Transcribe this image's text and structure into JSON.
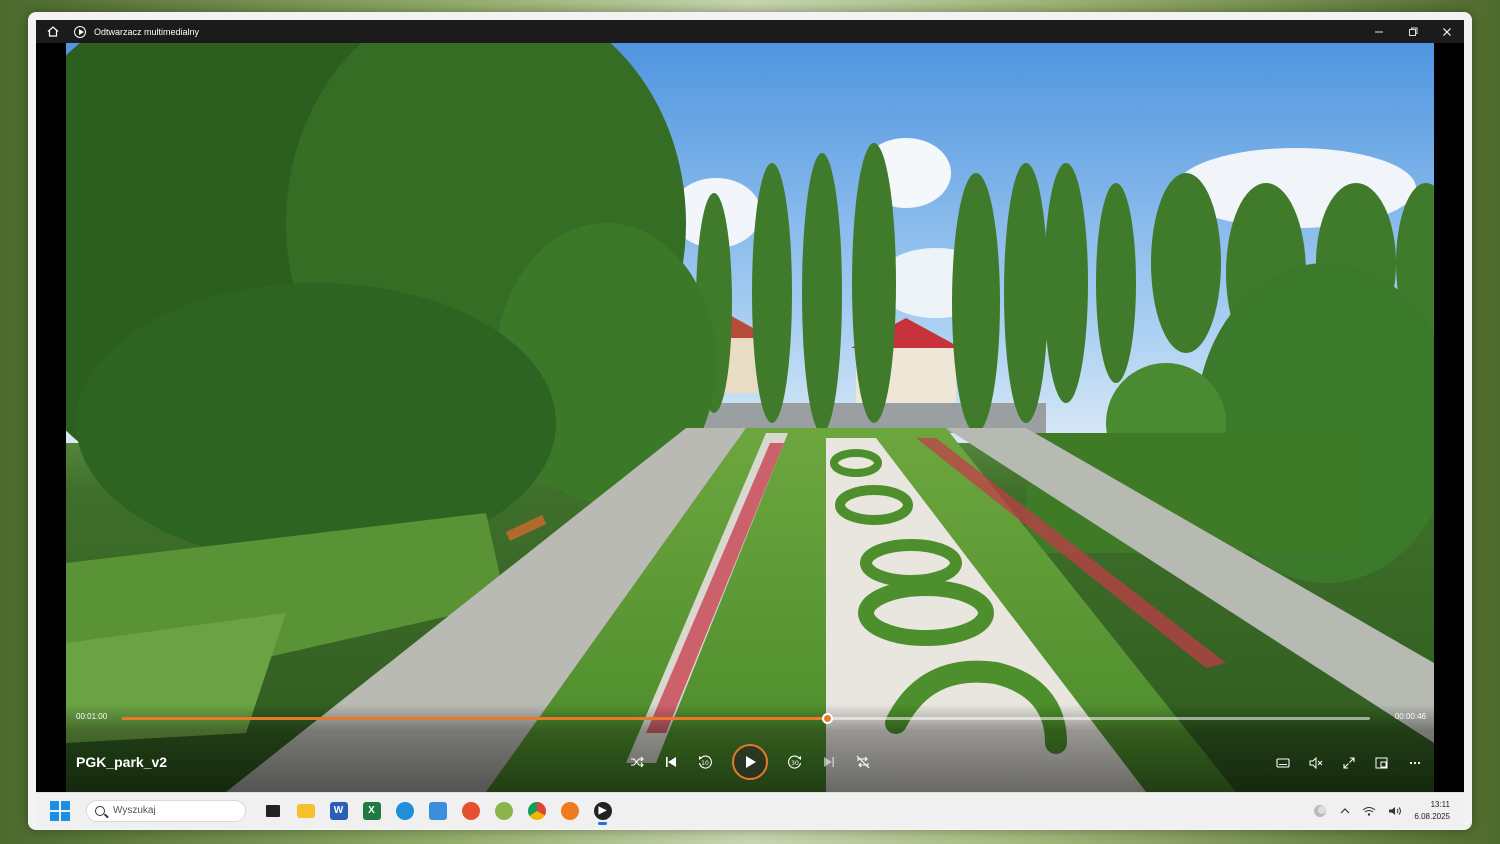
{
  "titlebar": {
    "title": "Odtwarzacz multimedialny"
  },
  "player": {
    "file_name": "PGK_park_v2",
    "current_time": "00:01:00",
    "total_time": "00:00:46",
    "progress": 0.565
  },
  "colors": {
    "accent": "#e8782a"
  },
  "taskbar": {
    "search_placeholder": "Wyszukaj",
    "time": "13:11",
    "date": "6.08.2025"
  },
  "icons": {
    "titlebar": [
      "home-icon",
      "app-icon",
      "minimize-icon",
      "maximize-icon",
      "close-icon"
    ],
    "controls": [
      "shuffle-icon",
      "previous-icon",
      "rewind-10-icon",
      "play-icon",
      "forward-30-icon",
      "next-icon",
      "repeat-off-icon"
    ],
    "right": [
      "subtitles-icon",
      "mute-icon",
      "fullscreen-icon",
      "miniplayer-icon",
      "more-icon"
    ]
  }
}
